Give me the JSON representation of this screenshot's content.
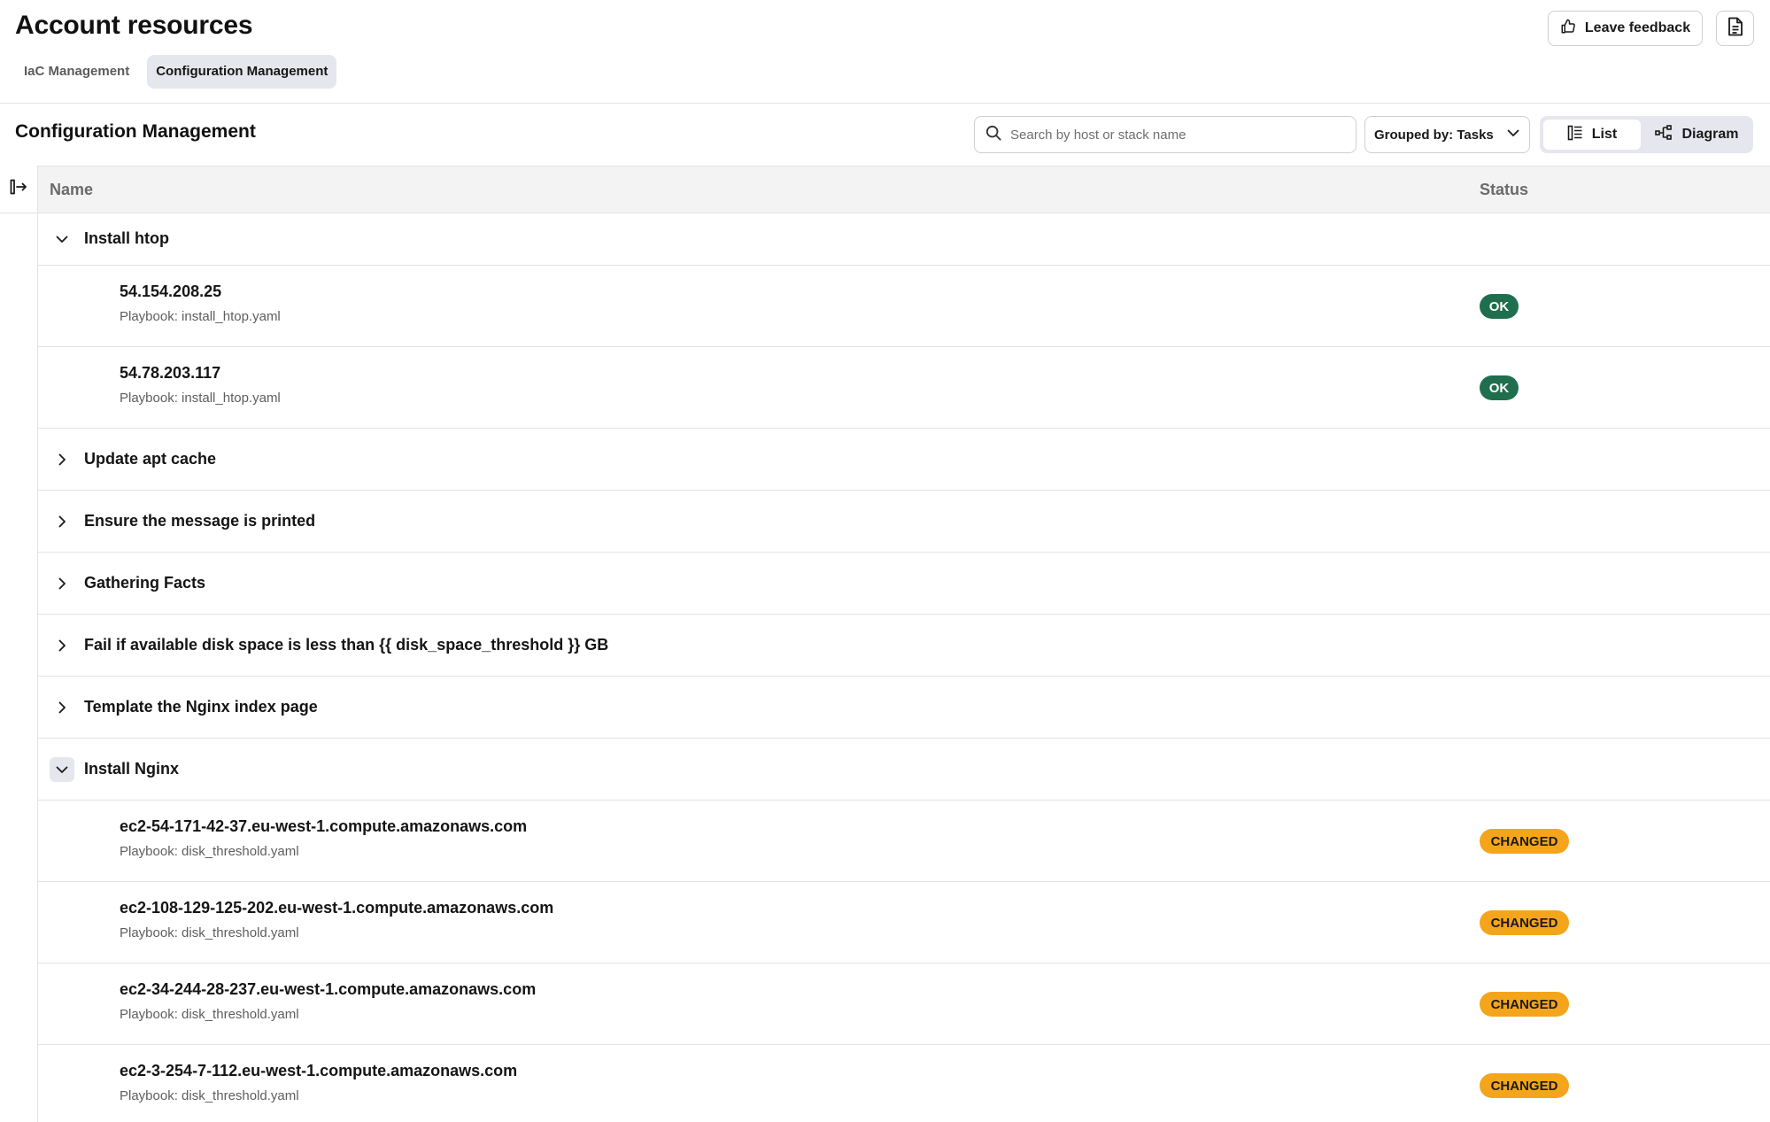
{
  "header": {
    "title": "Account resources",
    "tabs": [
      {
        "label": "IaC Management",
        "active": false
      },
      {
        "label": "Configuration Management",
        "active": true
      }
    ],
    "feedback_label": "Leave feedback",
    "doc_icon": "document-icon"
  },
  "section": {
    "title": "Configuration Management",
    "search_placeholder": "Search by host or stack name",
    "group_by_label": "Grouped by: Tasks",
    "view_list_label": "List",
    "view_diagram_label": "Diagram",
    "active_view": "List"
  },
  "table": {
    "col_name": "Name",
    "col_status": "Status"
  },
  "groups": [
    {
      "label": "Install htop",
      "expanded": true,
      "hosts": [
        {
          "name": "54.154.208.25",
          "playbook": "Playbook: install_htop.yaml",
          "status": "OK"
        },
        {
          "name": "54.78.203.117",
          "playbook": "Playbook: install_htop.yaml",
          "status": "OK"
        }
      ]
    },
    {
      "label": "Update apt cache",
      "expanded": false
    },
    {
      "label": "Ensure the message is printed",
      "expanded": false
    },
    {
      "label": "Gathering Facts",
      "expanded": false
    },
    {
      "label": "Fail if available disk space is less than {{ disk_space_threshold }} GB",
      "expanded": false
    },
    {
      "label": "Template the Nginx index page",
      "expanded": false
    },
    {
      "label": "Install Nginx",
      "expanded": true,
      "hosts": [
        {
          "name": "ec2-54-171-42-37.eu-west-1.compute.amazonaws.com",
          "playbook": "Playbook: disk_threshold.yaml",
          "status": "CHANGED"
        },
        {
          "name": "ec2-108-129-125-202.eu-west-1.compute.amazonaws.com",
          "playbook": "Playbook: disk_threshold.yaml",
          "status": "CHANGED"
        },
        {
          "name": "ec2-34-244-28-237.eu-west-1.compute.amazonaws.com",
          "playbook": "Playbook: disk_threshold.yaml",
          "status": "CHANGED"
        },
        {
          "name": "ec2-3-254-7-112.eu-west-1.compute.amazonaws.com",
          "playbook": "Playbook: disk_threshold.yaml",
          "status": "CHANGED"
        }
      ]
    }
  ],
  "colors": {
    "ok": "#1f6f4f",
    "changed": "#f4a51c",
    "tab_active_bg": "#e6e7ee"
  }
}
